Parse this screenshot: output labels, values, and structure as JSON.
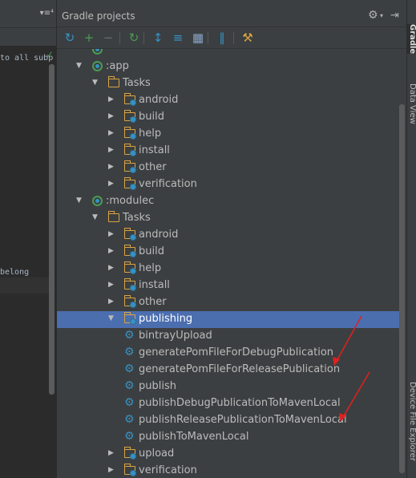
{
  "editor": {
    "tab_controls": "▾≡⁴",
    "code_line_1": "to all subp",
    "code_line_2": "belong"
  },
  "panel": {
    "title": "Gradle projects",
    "gear_icon": "gear-icon",
    "hide_icon": "hide-icon"
  },
  "toolbar": [
    {
      "name": "refresh-all-icon",
      "glyph": "↻",
      "color": "#3592c4"
    },
    {
      "name": "add-project-icon",
      "glyph": "+",
      "color": "#499c54"
    },
    {
      "name": "remove-project-icon",
      "glyph": "−",
      "color": "#6b6b6b"
    },
    {
      "name": "run-task-icon",
      "glyph": "↻",
      "color": "#499c54"
    },
    {
      "name": "expand-all-icon",
      "glyph": "↕",
      "color": "#3592c4"
    },
    {
      "name": "collapse-all-icon",
      "glyph": "≡",
      "color": "#3592c4"
    },
    {
      "name": "group-modules-icon",
      "glyph": "▦",
      "color": "#8aa4c8"
    },
    {
      "name": "toggle-offline-icon",
      "glyph": "∥",
      "color": "#3592c4"
    },
    {
      "name": "settings-icon",
      "glyph": "⚒",
      "color": "#d9a343"
    }
  ],
  "tree": [
    {
      "label": "",
      "type": "module",
      "indent": 0,
      "arrow": "",
      "partial": true
    },
    {
      "label": ":app",
      "type": "module",
      "indent": 0,
      "arrow": "open"
    },
    {
      "label": "Tasks",
      "type": "folder",
      "indent": 1,
      "arrow": "open"
    },
    {
      "label": "android",
      "type": "taskfolder",
      "indent": 2,
      "arrow": "closed"
    },
    {
      "label": "build",
      "type": "taskfolder",
      "indent": 2,
      "arrow": "closed"
    },
    {
      "label": "help",
      "type": "taskfolder",
      "indent": 2,
      "arrow": "closed"
    },
    {
      "label": "install",
      "type": "taskfolder",
      "indent": 2,
      "arrow": "closed"
    },
    {
      "label": "other",
      "type": "taskfolder",
      "indent": 2,
      "arrow": "closed"
    },
    {
      "label": "verification",
      "type": "taskfolder",
      "indent": 2,
      "arrow": "closed"
    },
    {
      "label": ":modulec",
      "type": "module",
      "indent": 0,
      "arrow": "open"
    },
    {
      "label": "Tasks",
      "type": "folder",
      "indent": 1,
      "arrow": "open"
    },
    {
      "label": "android",
      "type": "taskfolder",
      "indent": 2,
      "arrow": "closed"
    },
    {
      "label": "build",
      "type": "taskfolder",
      "indent": 2,
      "arrow": "closed"
    },
    {
      "label": "help",
      "type": "taskfolder",
      "indent": 2,
      "arrow": "closed"
    },
    {
      "label": "install",
      "type": "taskfolder",
      "indent": 2,
      "arrow": "closed"
    },
    {
      "label": "other",
      "type": "taskfolder",
      "indent": 2,
      "arrow": "closed"
    },
    {
      "label": "publishing",
      "type": "taskfolder",
      "indent": 2,
      "arrow": "open",
      "selected": true
    },
    {
      "label": "bintrayUpload",
      "type": "task",
      "indent": 3,
      "arrow": ""
    },
    {
      "label": "generatePomFileForDebugPublication",
      "type": "task",
      "indent": 3,
      "arrow": ""
    },
    {
      "label": "generatePomFileForReleasePublication",
      "type": "task",
      "indent": 3,
      "arrow": ""
    },
    {
      "label": "publish",
      "type": "task",
      "indent": 3,
      "arrow": ""
    },
    {
      "label": "publishDebugPublicationToMavenLocal",
      "type": "task",
      "indent": 3,
      "arrow": ""
    },
    {
      "label": "publishReleasePublicationToMavenLocal",
      "type": "task",
      "indent": 3,
      "arrow": ""
    },
    {
      "label": "publishToMavenLocal",
      "type": "task",
      "indent": 3,
      "arrow": ""
    },
    {
      "label": "upload",
      "type": "taskfolder",
      "indent": 2,
      "arrow": "closed"
    },
    {
      "label": "verification",
      "type": "taskfolder",
      "indent": 2,
      "arrow": "closed"
    }
  ],
  "right_tabs": {
    "gradle": "Gradle",
    "data_view": "Data View",
    "device_file_explorer": "Device File Explorer"
  },
  "colors": {
    "selection": "#4b6eaf",
    "annotation_arrow": "#e0211d"
  }
}
